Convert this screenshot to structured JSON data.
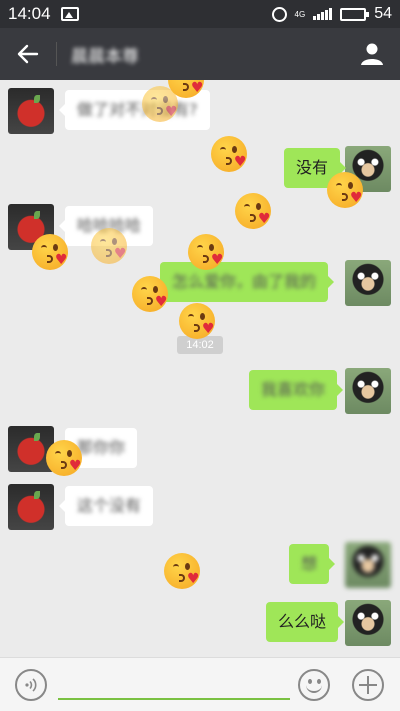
{
  "status_bar": {
    "time": "14:04",
    "network": "4G",
    "battery_level": "54",
    "battery_fraction": 0.54
  },
  "title_bar": {
    "title": "晨晨本尊"
  },
  "messages": [
    {
      "side": "left",
      "sender": "apple",
      "text": "做了对不对没有?",
      "obscured": true
    },
    {
      "side": "right",
      "sender": "bear",
      "text": "没有",
      "obscured": false
    },
    {
      "side": "left",
      "sender": "apple",
      "text": "哈哈哈哈",
      "obscured": true
    },
    {
      "side": "right",
      "sender": "bear",
      "text": "怎么爱你，由了我的",
      "obscured": true
    },
    {
      "side": "right",
      "sender": "bear",
      "text": "我喜欢你",
      "obscured": true
    },
    {
      "side": "left",
      "sender": "apple",
      "text": "那你你",
      "obscured": true
    },
    {
      "side": "left",
      "sender": "apple",
      "text": "这个没有",
      "obscured": true
    },
    {
      "side": "right",
      "sender": "bear",
      "text": "想",
      "obscured": true
    },
    {
      "side": "right",
      "sender": "bear",
      "text": "么么哒",
      "obscured": false
    }
  ],
  "timestamp": "14:02",
  "floating_emoji": "kissing-face-with-heart-icon",
  "input_bar": {
    "placeholder": ""
  },
  "colors": {
    "title_bar": "#393a3f",
    "status_bar": "#2e2f33",
    "chat_background": "#ebebeb",
    "bubble_sent": "#9fe658",
    "bubble_received": "#ffffff",
    "input_underline": "#7ac142"
  }
}
